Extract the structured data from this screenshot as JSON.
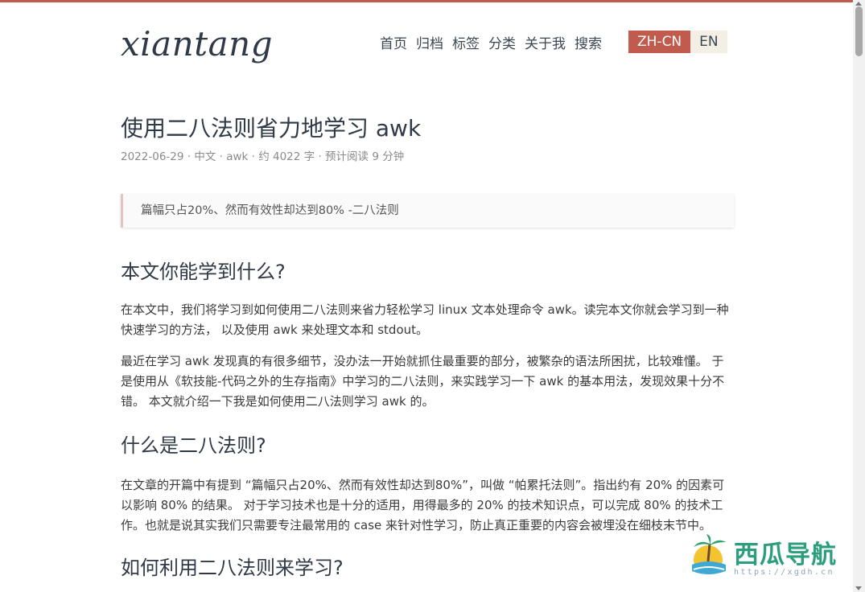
{
  "site": {
    "logo": "xiantang",
    "nav": [
      "首页",
      "归档",
      "标签",
      "分类",
      "关于我",
      "搜索"
    ],
    "lang": {
      "active": "ZH-CN",
      "inactive": "EN"
    }
  },
  "post": {
    "title": "使用二八法则省力地学习 awk",
    "meta": "2022-06-29 · 中文 · awk · 约 4022 字 · 预计阅读 9 分钟",
    "quote": "篇幅只占20%、然而有效性却达到80% -二八法则",
    "sections": [
      {
        "heading": "本文你能学到什么?",
        "paragraphs": [
          "在本文中，我们将学习到如何使用二八法则来省力轻松学习 linux 文本处理命令 awk。读完本文你就会学习到一种快速学习的方法， 以及使用 awk 来处理文本和 stdout。",
          "最近在学习 awk 发现真的有很多细节，没办法一开始就抓住最重要的部分，被繁杂的语法所困扰，比较难懂。 于是使用从《软技能-代码之外的生存指南》中学习的二八法则，来实践学习一下 awk 的基本用法，发现效果十分不错。 本文就介绍一下我是如何使用二八法则学习 awk 的。"
        ]
      },
      {
        "heading": "什么是二八法则?",
        "paragraphs": [
          "在文章的开篇中有提到 “篇幅只占20%、然而有效性却达到80%”，叫做 “帕累托法则”。指出约有 20% 的因素可以影响 80% 的结果。 对于学习技术也是十分的适用，用得最多的 20% 的技术知识点，可以完成 80% 的技术工作。也就是说其实我们只需要专注最常用的 case 来针对性学习，防止真正重要的内容会被埋没在细枝末节中。"
        ]
      },
      {
        "heading": "如何利用二八法则来学习?",
        "paragraphs": []
      }
    ]
  },
  "watermark": {
    "text": "西瓜导航",
    "url": "https://xgdh.cn"
  },
  "colors": {
    "accent": "#c05b4d",
    "text": "#2f3a46",
    "watermark": "#2c9e7d"
  }
}
